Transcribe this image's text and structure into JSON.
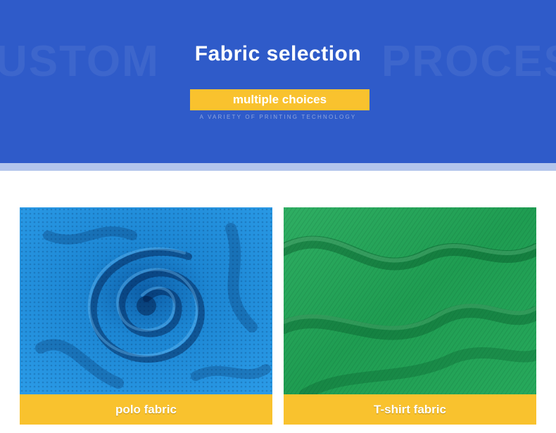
{
  "header": {
    "watermark_left": "USTOM",
    "watermark_right": "PROCES",
    "title": "Fabric selection",
    "badge": "multiple choices",
    "subtitle": "A VARIETY OF PRINTING TECHNOLOGY"
  },
  "colors": {
    "banner": "#2f5bc9",
    "accent": "#f9c22e",
    "polo_fabric": "#1f8fd8",
    "tshirt_fabric": "#23a557"
  },
  "cards": [
    {
      "label": "polo fabric",
      "swatch": "blue-knit-fabric"
    },
    {
      "label": "T-shirt fabric",
      "swatch": "green-jersey-fabric"
    }
  ]
}
